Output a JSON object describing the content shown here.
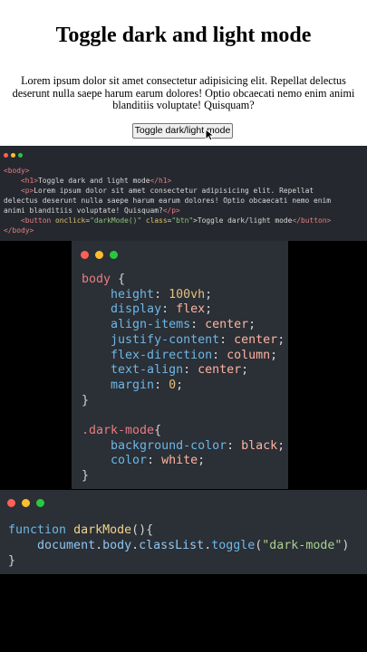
{
  "demo": {
    "title": "Toggle dark and light mode",
    "paragraph": "Lorem ipsum dolor sit amet consectetur adipisicing elit. Repellat delectus deserunt nulla saepe harum earum dolores! Optio obcaecati nemo enim animi blanditiis voluptate! Quisquam?",
    "button_label": "Toggle dark/light mode"
  },
  "html_snippet": {
    "open_body": "<body>",
    "h1_open": "<h1>",
    "h1_text": "Toggle dark and light mode",
    "h1_close": "</h1>",
    "p_open": "<p>",
    "p_text_1": "Lorem ipsum dolor sit amet consectetur adipisicing elit. Repellat",
    "p_text_2": "delectus deserunt nulla saepe harum earum dolores! Optio obcaecati nemo enim",
    "p_text_3": "animi blanditiis voluptate! Quisquam?",
    "p_close": "</p>",
    "btn_tag": "<button",
    "btn_attr1": "onclick",
    "btn_val1": "\"darkMode()\"",
    "btn_attr2": "class",
    "btn_val2": "\"btn\"",
    "btn_text": "Toggle dark/light mode",
    "btn_close": "</button>",
    "close_body": "</body>"
  },
  "css_snippet": {
    "body_selector": "body",
    "body_rules": [
      {
        "prop": "height",
        "val": "100vh"
      },
      {
        "prop": "display",
        "val": "flex"
      },
      {
        "prop": "align-items",
        "val": "center"
      },
      {
        "prop": "justify-content",
        "val": "center"
      },
      {
        "prop": "flex-direction",
        "val": "column"
      },
      {
        "prop": "text-align",
        "val": "center"
      },
      {
        "prop": "margin",
        "val": "0"
      }
    ],
    "dark_selector": ".dark-mode",
    "dark_rules": [
      {
        "prop": "background-color",
        "val": "black"
      },
      {
        "prop": "color",
        "val": "white"
      }
    ]
  },
  "js_snippet": {
    "keyword": "function",
    "name": "darkMode",
    "signature_rest": "(){",
    "obj": "document",
    "body": "body",
    "classlist": "classList",
    "method": "toggle",
    "arg": "\"dark-mode\"",
    "close": "}"
  },
  "colors": {
    "dot_red": "#ff5f56",
    "dot_yellow": "#ffbd2e",
    "dot_green": "#27c93f",
    "code_bg": "#2b2f36",
    "page_bg": "#000000"
  }
}
